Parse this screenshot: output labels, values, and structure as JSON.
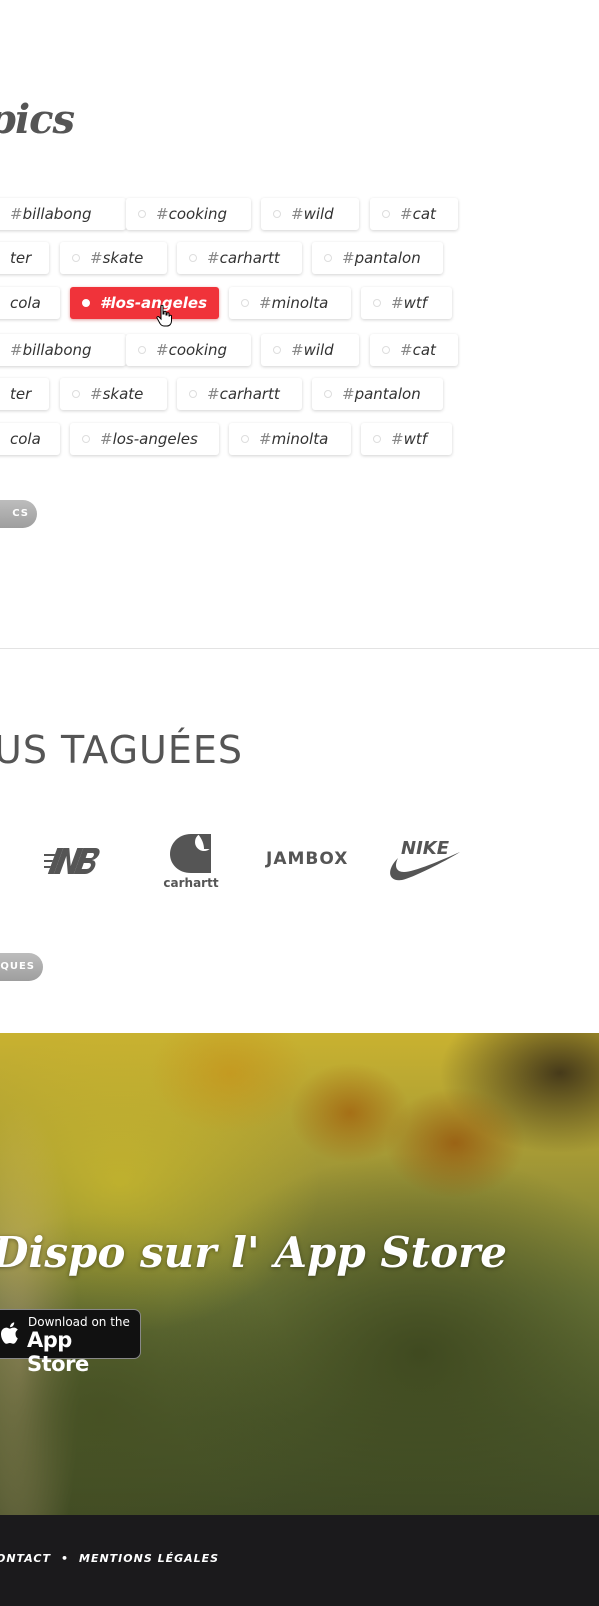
{
  "topics": {
    "title": "pics",
    "rows": [
      [
        {
          "name": "billabong",
          "active": false
        },
        {
          "name": "cooking",
          "active": false
        },
        {
          "name": "wild",
          "active": false
        },
        {
          "name": "cat",
          "active": false
        }
      ],
      [
        {
          "name": "ter",
          "active": false
        },
        {
          "name": "skate",
          "active": false
        },
        {
          "name": "carhartt",
          "active": false
        },
        {
          "name": "pantalon",
          "active": false
        }
      ],
      [
        {
          "name": "cola",
          "active": false
        },
        {
          "name": "los-angeles",
          "active": true
        },
        {
          "name": "minolta",
          "active": false
        },
        {
          "name": "wtf",
          "active": false
        }
      ],
      [
        {
          "name": "billabong",
          "active": false
        },
        {
          "name": "cooking",
          "active": false
        },
        {
          "name": "wild",
          "active": false
        },
        {
          "name": "cat",
          "active": false
        }
      ],
      [
        {
          "name": "ter",
          "active": false
        },
        {
          "name": "skate",
          "active": false
        },
        {
          "name": "carhartt",
          "active": false
        },
        {
          "name": "pantalon",
          "active": false
        }
      ],
      [
        {
          "name": "cola",
          "active": false
        },
        {
          "name": "los-angeles",
          "active": false
        },
        {
          "name": "minolta",
          "active": false
        },
        {
          "name": "wtf",
          "active": false
        }
      ]
    ],
    "hash": "#",
    "more_button": "CS"
  },
  "brands": {
    "title": "US TAGUÉES",
    "logos": [
      "new-balance-logo",
      "carhartt-logo",
      "jambox-logo",
      "nike-logo"
    ],
    "carhartt_text": "carhartt",
    "jambox_text": "JAMBOX",
    "nike_text": "NIKE",
    "more_button": "QUES"
  },
  "appstore": {
    "title": "Dispo sur l' App Store",
    "badge_small": "Download on the",
    "badge_big": "App Store"
  },
  "footer": {
    "links": [
      "ONTACT",
      "MENTIONS LÉGALES"
    ],
    "separator": "•"
  },
  "colors": {
    "accent": "#f0333a",
    "footer_bg": "#1b1a1c",
    "text": "#444444"
  }
}
